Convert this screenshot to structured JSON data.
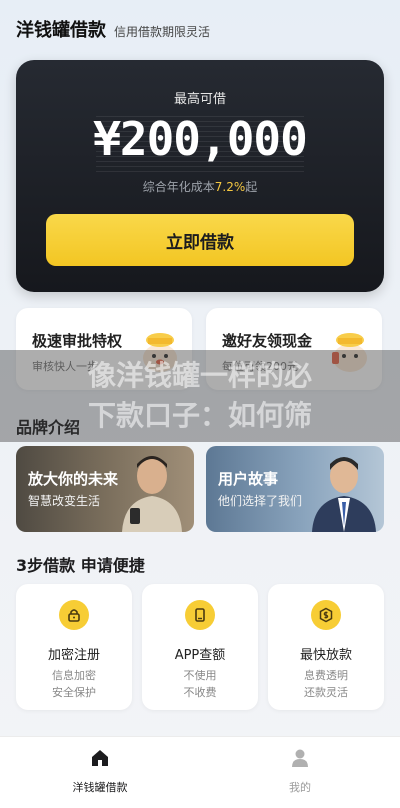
{
  "header": {
    "brand": "洋钱罐借款",
    "slogan": "信用借款期限灵活"
  },
  "hero": {
    "label": "最高可借",
    "amount": "¥200,000",
    "rate_prefix": "综合年化成本",
    "rate_value": "7.2%",
    "rate_suffix": "起",
    "cta_label": "立即借款"
  },
  "features": [
    {
      "title": "极速审批特权",
      "subtitle": "审核快人一步"
    },
    {
      "title": "邀好友领现金",
      "subtitle": "每位可领200元"
    }
  ],
  "overlay": {
    "line1": "像洋钱罐一样的必",
    "line2": "下款口子：如何筛"
  },
  "brand_section": {
    "title": "品牌介绍",
    "cards": [
      {
        "title": "放大你的未来",
        "subtitle": "智慧改变生活"
      },
      {
        "title": "用户故事",
        "subtitle": "他们选择了我们"
      }
    ]
  },
  "steps_section": {
    "title": "3步借款 申请便捷",
    "steps": [
      {
        "icon": "lock-icon",
        "title": "加密注册",
        "desc1": "信息加密",
        "desc2": "安全保护"
      },
      {
        "icon": "phone-icon",
        "title": "APP查额",
        "desc1": "不使用",
        "desc2": "不收费"
      },
      {
        "icon": "money-icon",
        "title": "最快放款",
        "desc1": "息费透明",
        "desc2": "还款灵活"
      }
    ]
  },
  "tabbar": {
    "tabs": [
      {
        "label": "洋钱罐借款",
        "icon": "home-icon",
        "active": true
      },
      {
        "label": "我的",
        "icon": "user-icon",
        "active": false
      }
    ]
  },
  "colors": {
    "accent": "#f5c842",
    "cta": "#f3c623",
    "hero_bg": "#1c1f25"
  }
}
